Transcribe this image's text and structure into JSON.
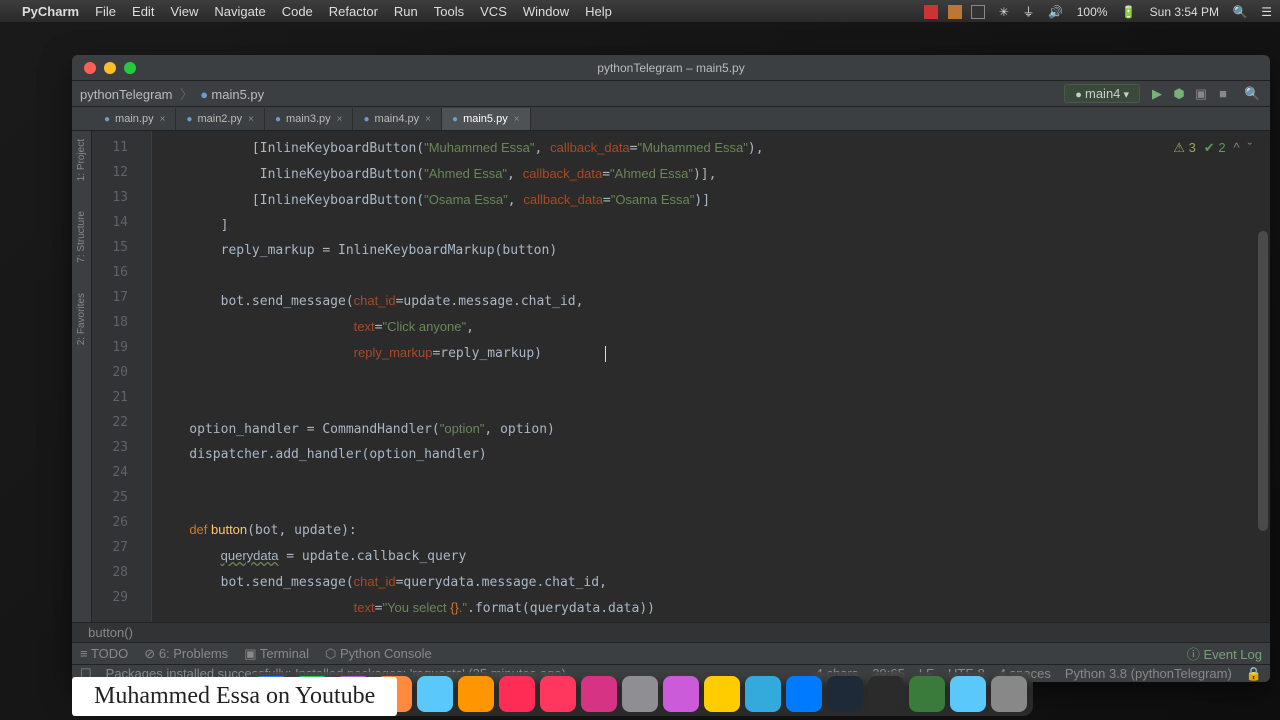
{
  "menubar": {
    "app": "PyCharm",
    "items": [
      "File",
      "Edit",
      "View",
      "Navigate",
      "Code",
      "Refactor",
      "Run",
      "Tools",
      "VCS",
      "Window",
      "Help"
    ],
    "right": {
      "battery": "100%",
      "time": "Sun 3:54 PM"
    }
  },
  "window": {
    "title": "pythonTelegram – main5.py",
    "breadcrumb": [
      "pythonTelegram",
      "main5.py"
    ],
    "runconfig": "main4",
    "tabs": [
      {
        "label": "main.py",
        "active": false
      },
      {
        "label": "main2.py",
        "active": false
      },
      {
        "label": "main3.py",
        "active": false
      },
      {
        "label": "main4.py",
        "active": false
      },
      {
        "label": "main5.py",
        "active": true
      }
    ],
    "sidetabs": [
      "1: Project",
      "7: Structure",
      "2: Favorites"
    ],
    "badges": {
      "warn": "3",
      "ok": "2"
    },
    "lines": [
      "11",
      "12",
      "13",
      "14",
      "15",
      "16",
      "17",
      "18",
      "19",
      "20",
      "21",
      "22",
      "23",
      "24",
      "25",
      "26",
      "27",
      "28",
      "29"
    ],
    "crumb_func": "button()",
    "bottom_tabs": [
      "TODO",
      "6: Problems",
      "Terminal",
      "Python Console"
    ],
    "event_log": "Event Log",
    "msg": "Packages installed successfully: Installed packages: 'requests' (25 minutes ago)",
    "status": {
      "chars": "4 chars",
      "pos": "29:65",
      "lf": "LF",
      "enc": "UTF-8",
      "indent": "4 spaces",
      "interp": "Python 3.8 (pythonTelegram)"
    }
  },
  "caption": "Muhammed Essa on Youtube",
  "code_lines": [
    {
      "indent": "            ",
      "html": "[InlineKeyboardButton(<span class='s'>\"Muhammed Essa\"</span>, <span class='p'>callback_data</span>=<span class='s'>\"Muhammed Essa\"</span>),"
    },
    {
      "indent": "             ",
      "html": "InlineKeyboardButton(<span class='s'>\"Ahmed Essa\"</span>, <span class='p'>callback_data</span>=<span class='s'>\"Ahmed Essa\"</span>)],"
    },
    {
      "indent": "            ",
      "html": "[InlineKeyboardButton(<span class='s'>\"Osama Essa\"</span>, <span class='p'>callback_data</span>=<span class='s'>\"Osama Essa\"</span>)]"
    },
    {
      "indent": "        ",
      "html": "]"
    },
    {
      "indent": "        ",
      "html": "reply_markup = InlineKeyboardMarkup(button)"
    },
    {
      "indent": "",
      "html": ""
    },
    {
      "indent": "        ",
      "html": "bot.send_message(<span class='p'>chat_id</span>=update.message.chat_id,"
    },
    {
      "indent": "                         ",
      "html": "<span class='p'>text</span>=<span class='s'>\"Click anyone\"</span>,"
    },
    {
      "indent": "                         ",
      "html": "<span class='p'>reply_markup</span>=reply_markup)        <span class='cursor'></span>"
    },
    {
      "indent": "",
      "html": ""
    },
    {
      "indent": "",
      "html": ""
    },
    {
      "indent": "    ",
      "html": "option_handler = CommandHandler(<span class='s'>\"option\"</span>, option)"
    },
    {
      "indent": "    ",
      "html": "dispatcher.add_handler(option_handler)"
    },
    {
      "indent": "",
      "html": ""
    },
    {
      "indent": "",
      "html": ""
    },
    {
      "indent": "    ",
      "html": "<span class='k'>def </span><span class='fn'>button</span>(bot, update):"
    },
    {
      "indent": "        ",
      "html": "<span class='wavy'>querydata</span> = update.callback_query"
    },
    {
      "indent": "        ",
      "html": "bot.send_message(<span class='p'>chat_id</span>=querydata.message.chat_id,"
    },
    {
      "indent": "                         ",
      "html": "<span class='p'>text</span>=<span class='s'>\"You select </span><span class='k'>{}</span><span class='s'>.\"</span>.format(querydata.data))"
    }
  ],
  "dock_colors": [
    "#3478f6",
    "#34c759",
    "#a166d6",
    "#ff8a3d",
    "#5ac8fa",
    "#ff9500",
    "#ff2d55",
    "#ff375f",
    "#d63384",
    "#8e8e93",
    "#cb5bd8",
    "#ffcc00",
    "#34aadc",
    "#007aff",
    "#1e2a38",
    "#2b2b2b",
    "#3a7a3a",
    "#5ac8fa",
    "#888"
  ]
}
